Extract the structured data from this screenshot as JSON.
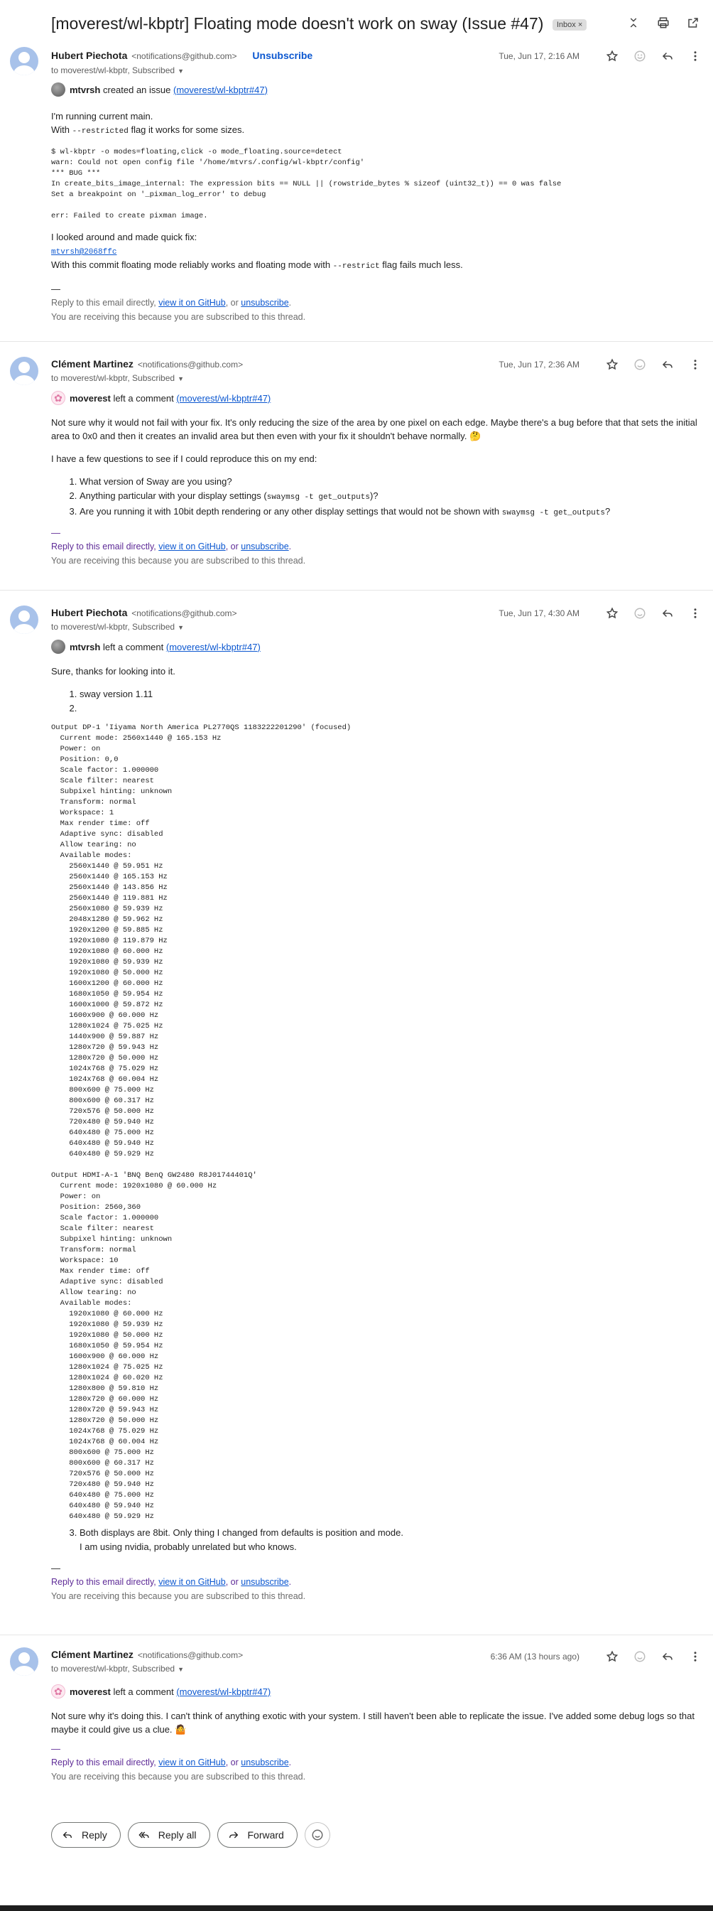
{
  "thread": {
    "subject": "[moverest/wl-kbptr] Floating mode doesn't work on sway (Issue #47)",
    "label": "Inbox",
    "label_close": "×"
  },
  "common": {
    "to": "to moverest/wl-kbptr, Subscribed",
    "footer_reply_prefix": "Reply to this email directly, ",
    "footer_view": "view it on GitHub",
    "footer_or": ", or ",
    "footer_unsub": "unsubscribe",
    "footer_end": ".",
    "footer_receiving": "You are receiving this because you are subscribed to this thread.",
    "dash": "—"
  },
  "messages": [
    {
      "sender": "Hubert Piechota",
      "email": "<notifications@github.com>",
      "unsubscribe": "Unsubscribe",
      "date": "Tue, Jun 17, 2:16 AM",
      "actor": "mtvrsh",
      "action": "created an issue",
      "ref": "(moverest/wl-kbptr#47)",
      "p1": "I'm running current main.",
      "p2_pre": "With ",
      "p2_code": "--restricted",
      "p2_post": " flag it works for some sizes.",
      "code1": "$ wl-kbptr -o modes=floating,click -o mode_floating.source=detect\nwarn: Could not open config file '/home/mtvrs/.config/wl-kbptr/config'\n*** BUG ***\nIn create_bits_image_internal: The expression bits == NULL || (rowstride_bytes % sizeof (uint32_t)) == 0 was false\nSet a breakpoint on '_pixman_log_error' to debug",
      "code2": "err: Failed to create pixman image.",
      "p3": "I looked around and made quick fix:",
      "commit": "mtvrsh@2068ffc",
      "p4_pre": "With this commit floating mode reliably works and floating mode with ",
      "p4_code": "--restrict",
      "p4_post": " flag fails much less."
    },
    {
      "sender": "Clément Martinez",
      "email": "<notifications@github.com>",
      "date": "Tue, Jun 17, 2:36 AM",
      "actor": "moverest",
      "action": "left a comment",
      "ref": "(moverest/wl-kbptr#47)",
      "p1": "Not sure why it would not fail with your fix. It's only reducing the size of the area by one pixel on each edge. Maybe there's a bug before that that sets the initial area to 0x0 and then it creates an invalid area but then even with your fix it shouldn't behave normally. 🤔",
      "p2": "I have a few questions to see if I could reproduce this on my end:",
      "q1": "What version of Sway are you using?",
      "q2_pre": "Anything particular with your display settings (",
      "q2_code": "swaymsg -t get_outputs",
      "q2_post": ")?",
      "q3_pre": "Are you running it with 10bit depth rendering or any other display settings that would not be shown with ",
      "q3_code": "swaymsg -t get_outputs",
      "q3_post": "?"
    },
    {
      "sender": "Hubert Piechota",
      "email": "<notifications@github.com>",
      "date": "Tue, Jun 17, 4:30 AM",
      "actor": "mtvrsh",
      "action": "left a comment",
      "ref": "(moverest/wl-kbptr#47)",
      "p1": "Sure, thanks for looking into it.",
      "a1": "sway version 1.11",
      "a2": "",
      "outputs1": "Output DP-1 'Iiyama North America PL2770QS 1183222201290' (focused)\n  Current mode: 2560x1440 @ 165.153 Hz\n  Power: on\n  Position: 0,0\n  Scale factor: 1.000000\n  Scale filter: nearest\n  Subpixel hinting: unknown\n  Transform: normal\n  Workspace: 1\n  Max render time: off\n  Adaptive sync: disabled\n  Allow tearing: no\n  Available modes:\n    2560x1440 @ 59.951 Hz\n    2560x1440 @ 165.153 Hz\n    2560x1440 @ 143.856 Hz\n    2560x1440 @ 119.881 Hz\n    2560x1080 @ 59.939 Hz\n    2048x1280 @ 59.962 Hz\n    1920x1200 @ 59.885 Hz\n    1920x1080 @ 119.879 Hz\n    1920x1080 @ 60.000 Hz\n    1920x1080 @ 59.939 Hz\n    1920x1080 @ 50.000 Hz\n    1600x1200 @ 60.000 Hz\n    1680x1050 @ 59.954 Hz\n    1600x1000 @ 59.872 Hz\n    1600x900 @ 60.000 Hz\n    1280x1024 @ 75.025 Hz\n    1440x900 @ 59.887 Hz\n    1280x720 @ 59.943 Hz\n    1280x720 @ 50.000 Hz\n    1024x768 @ 75.029 Hz\n    1024x768 @ 60.004 Hz\n    800x600 @ 75.000 Hz\n    800x600 @ 60.317 Hz\n    720x576 @ 50.000 Hz\n    720x480 @ 59.940 Hz\n    640x480 @ 75.000 Hz\n    640x480 @ 59.940 Hz\n    640x480 @ 59.929 Hz",
      "outputs2": "Output HDMI-A-1 'BNQ BenQ GW2480 R8J01744401Q'\n  Current mode: 1920x1080 @ 60.000 Hz\n  Power: on\n  Position: 2560,360\n  Scale factor: 1.000000\n  Scale filter: nearest\n  Subpixel hinting: unknown\n  Transform: normal\n  Workspace: 10\n  Max render time: off\n  Adaptive sync: disabled\n  Allow tearing: no\n  Available modes:\n    1920x1080 @ 60.000 Hz\n    1920x1080 @ 59.939 Hz\n    1920x1080 @ 50.000 Hz\n    1680x1050 @ 59.954 Hz\n    1600x900 @ 60.000 Hz\n    1280x1024 @ 75.025 Hz\n    1280x1024 @ 60.020 Hz\n    1280x800 @ 59.810 Hz\n    1280x720 @ 60.000 Hz\n    1280x720 @ 59.943 Hz\n    1280x720 @ 50.000 Hz\n    1024x768 @ 75.029 Hz\n    1024x768 @ 60.004 Hz\n    800x600 @ 75.000 Hz\n    800x600 @ 60.317 Hz\n    720x576 @ 50.000 Hz\n    720x480 @ 59.940 Hz\n    640x480 @ 75.000 Hz\n    640x480 @ 59.940 Hz\n    640x480 @ 59.929 Hz",
      "a3": "Both displays are 8bit. Only thing I changed from defaults is position and mode.",
      "a3b": "I am using nvidia, probably unrelated but who knows."
    },
    {
      "sender": "Clément Martinez",
      "email": "<notifications@github.com>",
      "date": "6:36 AM (13 hours ago)",
      "actor": "moverest",
      "action": "left a comment",
      "ref": "(moverest/wl-kbptr#47)",
      "p1": "Not sure why it's doing this. I can't think of anything exotic with your system. I still haven't been able to replicate the issue. I've added some debug logs so that maybe it could give us a clue. 🤷"
    }
  ],
  "reply_bar": {
    "reply": "Reply",
    "reply_all": "Reply all",
    "forward": "Forward"
  },
  "icons": [
    "collapse-icon",
    "print-icon",
    "open-new-window-icon",
    "star-icon",
    "emoji-icon",
    "reply-icon",
    "more-icon"
  ]
}
